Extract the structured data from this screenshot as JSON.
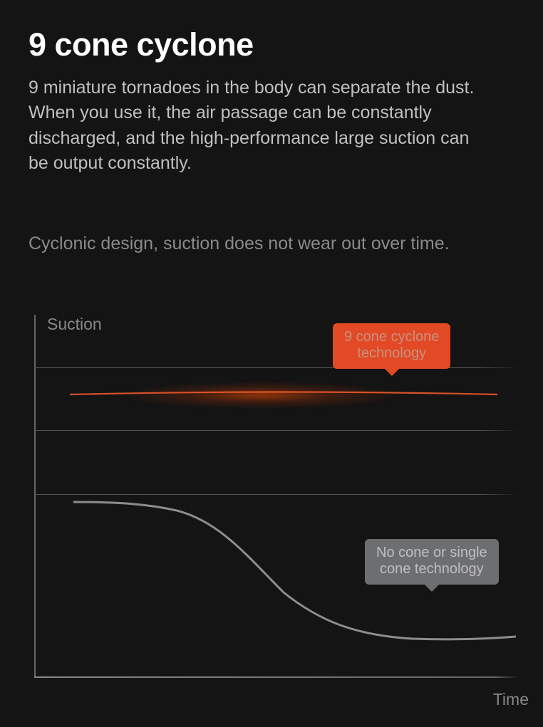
{
  "title": "9 cone cyclone",
  "body": "9 miniature tornadoes in the body can separate the dust. When you use it, the air passage can be constantly discharged, and the high-performance large suction can be output constantly.",
  "subheading": "Cyclonic design, suction does not wear out over time.",
  "chart_data": {
    "type": "line",
    "title": "",
    "xlabel": "Time",
    "ylabel": "Suction",
    "xlim": [
      0,
      100
    ],
    "ylim": [
      0,
      100
    ],
    "gridlines_y": [
      85,
      68,
      50
    ],
    "series": [
      {
        "name": "9 cone cyclone technology",
        "color": "#E24A25",
        "x": [
          5,
          10,
          20,
          30,
          40,
          50,
          60,
          70,
          80,
          90,
          100
        ],
        "values": [
          78,
          78.5,
          79,
          79.2,
          79.3,
          79.3,
          79.2,
          79,
          78.7,
          78.3,
          78
        ]
      },
      {
        "name": "No cone or single cone technology",
        "color": "#9b9b9b",
        "x": [
          5,
          10,
          20,
          30,
          40,
          50,
          60,
          70,
          80,
          90,
          100
        ],
        "values": [
          49,
          49,
          48,
          46,
          40,
          28,
          18,
          12,
          10,
          10,
          10
        ]
      }
    ],
    "callouts": {
      "orange": "9 cone cyclone\ntechnology",
      "grey": "No cone or single\ncone technology"
    }
  }
}
